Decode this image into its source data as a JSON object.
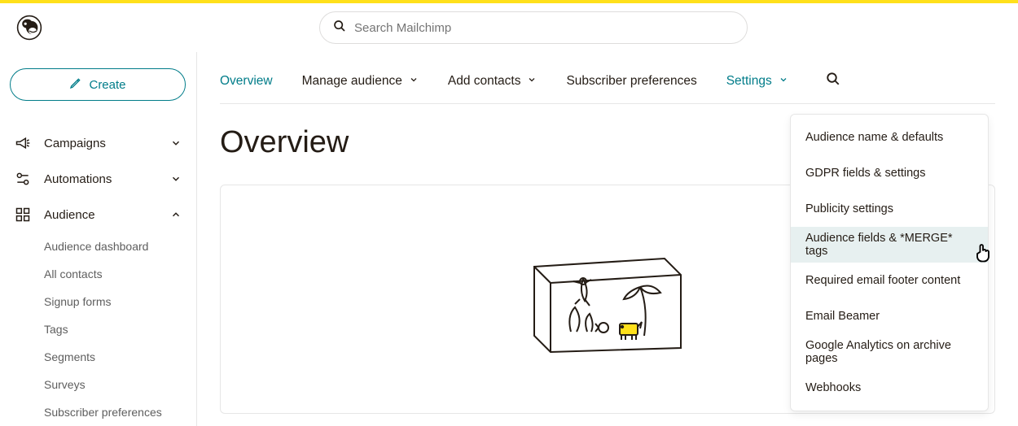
{
  "header": {
    "search_placeholder": "Search Mailchimp"
  },
  "sidebar": {
    "create_label": "Create",
    "nav": [
      {
        "label": "Campaigns",
        "expanded": false
      },
      {
        "label": "Automations",
        "expanded": false
      },
      {
        "label": "Audience",
        "expanded": true
      }
    ],
    "audience_sub": [
      {
        "label": "Audience dashboard"
      },
      {
        "label": "All contacts"
      },
      {
        "label": "Signup forms"
      },
      {
        "label": "Tags"
      },
      {
        "label": "Segments"
      },
      {
        "label": "Surveys"
      },
      {
        "label": "Subscriber preferences"
      }
    ]
  },
  "main": {
    "tabs": [
      {
        "label": "Overview",
        "active": true,
        "dropdown": false
      },
      {
        "label": "Manage audience",
        "active": false,
        "dropdown": true
      },
      {
        "label": "Add contacts",
        "active": false,
        "dropdown": true
      },
      {
        "label": "Subscriber preferences",
        "active": false,
        "dropdown": false
      },
      {
        "label": "Settings",
        "active": false,
        "dropdown": true,
        "teal": true
      }
    ],
    "page_title": "Overview",
    "settings_dropdown": [
      {
        "label": "Audience name & defaults"
      },
      {
        "label": "GDPR fields & settings"
      },
      {
        "label": "Publicity settings"
      },
      {
        "label": "Audience fields & *MERGE* tags",
        "highlight": true
      },
      {
        "label": "Required email footer content"
      },
      {
        "label": "Email Beamer"
      },
      {
        "label": "Google Analytics on archive pages"
      },
      {
        "label": "Webhooks"
      }
    ]
  },
  "colors": {
    "accent": "#007c89",
    "brand_yellow": "#ffe01b"
  }
}
